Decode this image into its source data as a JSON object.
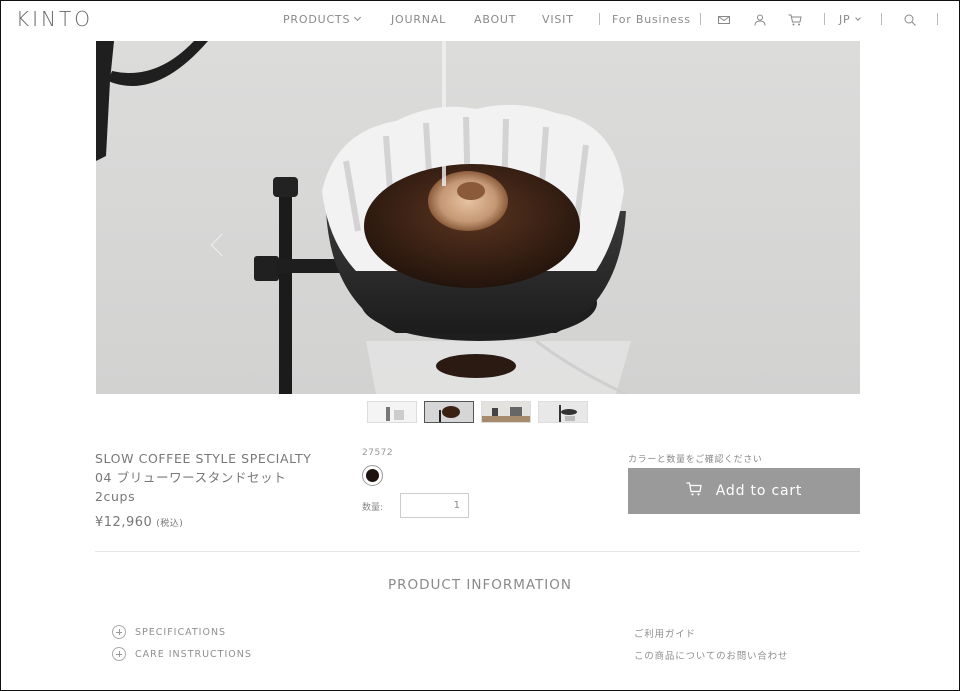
{
  "header": {
    "logo": "KINTO",
    "nav": {
      "products": "PRODUCTS",
      "journal": "JOURNAL",
      "about": "ABOUT",
      "visit": "VISIT",
      "business": "For Business"
    },
    "lang": "JP",
    "icons": [
      "mail-icon",
      "user-icon",
      "cart-icon",
      "search-icon"
    ]
  },
  "product": {
    "name_line1": "SLOW COFFEE STYLE SPECIALTY",
    "name_line2": "04 ブリューワースタンドセット",
    "name_line3": "2cups",
    "price": "¥12,960",
    "tax": "(税込)",
    "sku": "27572",
    "swatch_color": "#1d140f",
    "qty_label": "数量:",
    "qty_value": "1",
    "cart_note": "カラーと数量をご確認ください",
    "cart_label": "Add to cart"
  },
  "gallery": {
    "thumbnail_count": 4,
    "active_index": 1
  },
  "info": {
    "title": "PRODUCT INFORMATION",
    "specifications": "SPECIFICATIONS",
    "care": "CARE INSTRUCTIONS",
    "guide": "ご利用ガイド",
    "contact": "この商品についてのお問い合わせ"
  },
  "colors": {
    "button_bg": "#9a9a9a",
    "text": "#7a7a7a"
  }
}
